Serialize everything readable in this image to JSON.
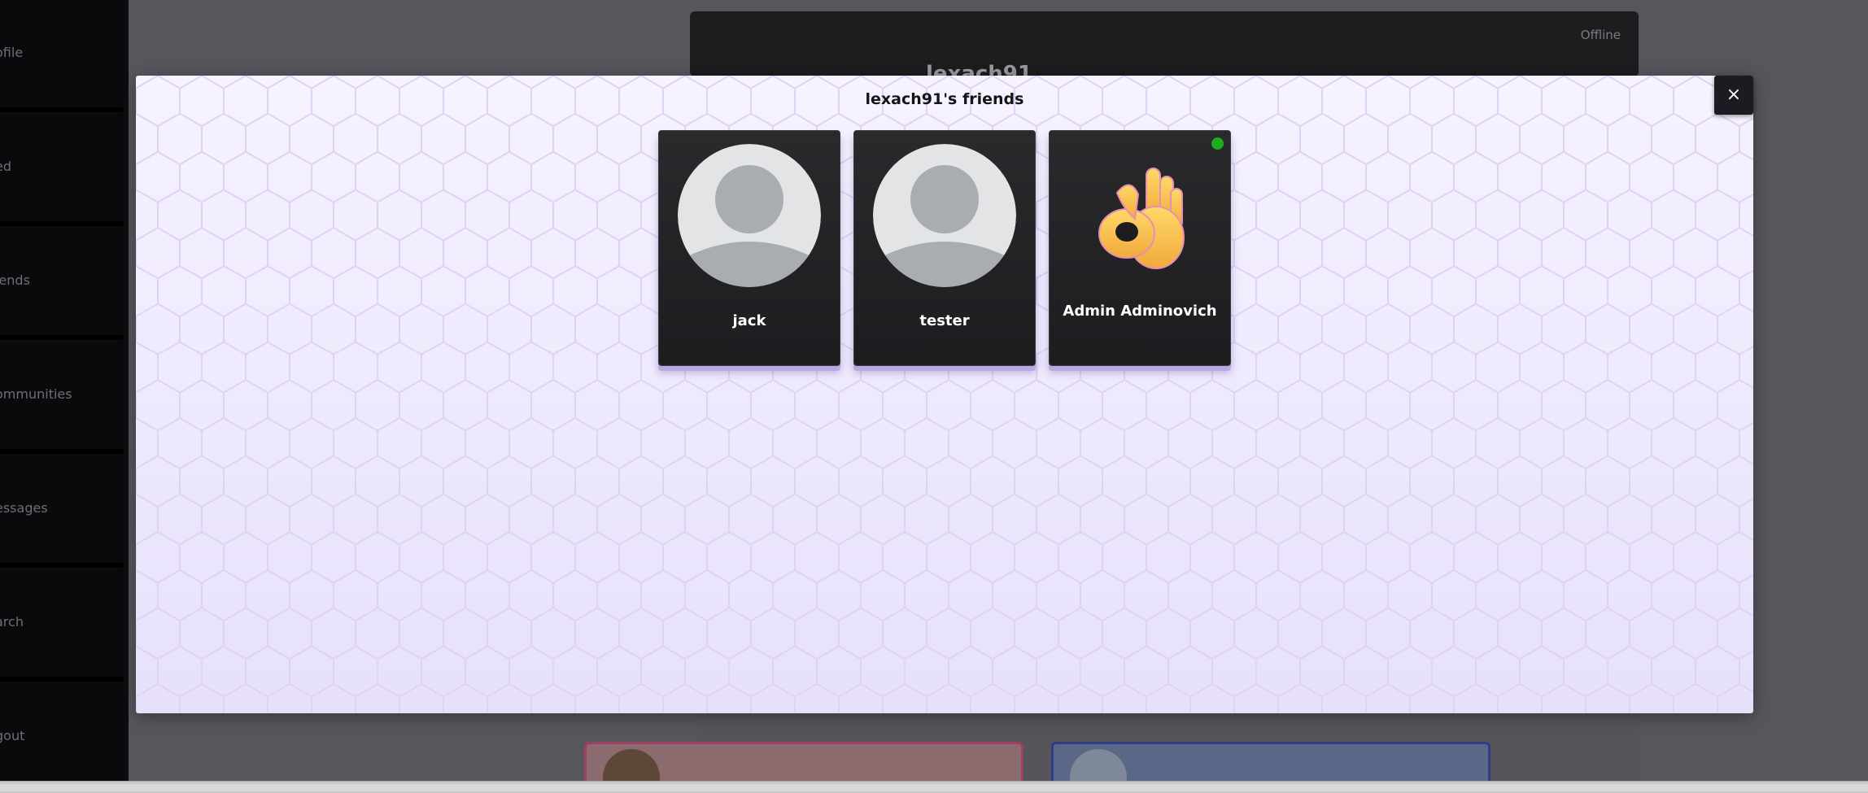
{
  "background": {
    "sidebar_items": [
      "ofile",
      "ed",
      "iends",
      "ommunities",
      "essages",
      "arch",
      "gout"
    ],
    "profile_name": "lexach91",
    "profile_status": "Offline"
  },
  "modal": {
    "title": "lexach91's friends",
    "close_label": "×",
    "friends": [
      {
        "name": "jack",
        "avatar": "default-avatar-icon",
        "online": false
      },
      {
        "name": "tester",
        "avatar": "default-avatar-icon",
        "online": false
      },
      {
        "name": "Admin Adminovich",
        "avatar": "ok-hand-emoji",
        "online": true
      }
    ]
  },
  "colors": {
    "card_bg": "#1d1d20",
    "online": "#1cae1c",
    "modal_bg": "#efeafc",
    "accent_shadow": "#b9a8e6"
  }
}
